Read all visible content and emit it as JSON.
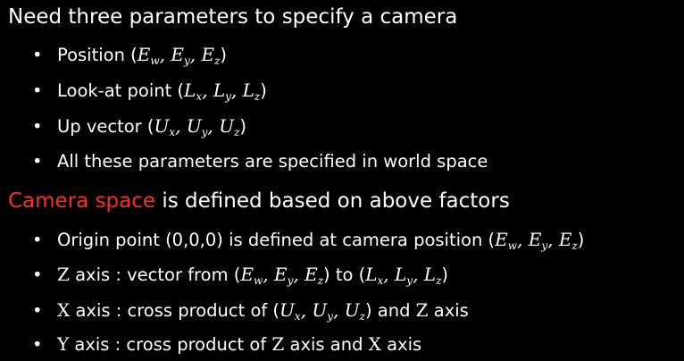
{
  "heading1": "Need three parameters to specify a camera",
  "heading2": {
    "accent": "Camera space",
    "rest": " is defined based on above factors"
  },
  "colors": {
    "background": "#000000",
    "text": "#ffffff",
    "accent": "#ff2a2a"
  },
  "bullet_glyph": "•",
  "list1": {
    "position": {
      "label": "Position (",
      "close": ")"
    },
    "lookat": {
      "label": "Look-at point (",
      "close": ")"
    },
    "up": {
      "label": "Up vector (",
      "close": ")"
    },
    "world": {
      "text": "All these parameters are specified in world space"
    }
  },
  "list2": {
    "origin": {
      "text": "Origin point (0,0,0) is defined at camera position (",
      "close": ")"
    },
    "zaxis": {
      "axis": "Z",
      "text1": " axis : vector from (",
      "mid": ") to (",
      "close": ")"
    },
    "xaxis": {
      "axis": "X",
      "text1": " axis : cross product of (",
      "mid": ") and ",
      "axis2": "Z",
      "text2": " axis"
    },
    "yaxis": {
      "axis": "Y",
      "text1": " axis : cross product of ",
      "axis2": "Z",
      "mid": " axis and ",
      "axis3": "X",
      "text2": " axis"
    }
  },
  "math": {
    "E": "E",
    "L": "L",
    "U": "U",
    "w": "w",
    "x": "x",
    "y": "y",
    "z": "z",
    "sep": ", "
  }
}
